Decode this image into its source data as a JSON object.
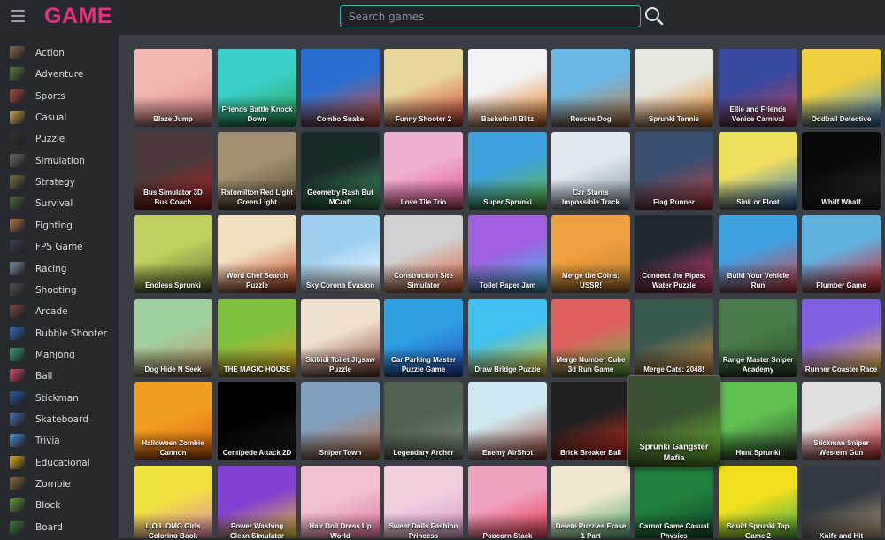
{
  "brand": {
    "logo": "GAME",
    "logo_color": "#e5337b"
  },
  "search": {
    "placeholder": "Search games"
  },
  "sidebar": {
    "items": [
      {
        "label": "Action",
        "icon": "action-icon",
        "color": "#8a6a4a"
      },
      {
        "label": "Adventure",
        "icon": "adventure-icon",
        "color": "#5a7a3a"
      },
      {
        "label": "Sports",
        "icon": "sports-icon",
        "color": "#b04a3a"
      },
      {
        "label": "Casual",
        "icon": "casual-icon",
        "color": "#c9a640"
      },
      {
        "label": "Puzzle",
        "icon": "puzzle-icon",
        "color": "#2c3a2c"
      },
      {
        "label": "Simulation",
        "icon": "simulation-icon",
        "color": "#6a6a6a"
      },
      {
        "label": "Strategy",
        "icon": "strategy-icon",
        "color": "#7a7040"
      },
      {
        "label": "Survival",
        "icon": "survival-icon",
        "color": "#4a6a3a"
      },
      {
        "label": "Fighting",
        "icon": "fighting-icon",
        "color": "#b07a3a"
      },
      {
        "label": "FPS Game",
        "icon": "fps-icon",
        "color": "#3a4050"
      },
      {
        "label": "Racing",
        "icon": "racing-icon",
        "color": "#7a8aa0"
      },
      {
        "label": "Shooting",
        "icon": "shooting-icon",
        "color": "#505050"
      },
      {
        "label": "Arcade",
        "icon": "arcade-icon",
        "color": "#7a4a3a"
      },
      {
        "label": "Bubble Shooter",
        "icon": "bubble-shooter-icon",
        "color": "#3a6ac0"
      },
      {
        "label": "Mahjong",
        "icon": "mahjong-icon",
        "color": "#3aa07a"
      },
      {
        "label": "Ball",
        "icon": "ball-icon",
        "color": "#d04a6a"
      },
      {
        "label": "Stickman",
        "icon": "stickman-icon",
        "color": "#2a5aa0"
      },
      {
        "label": "Skateboard",
        "icon": "skateboard-icon",
        "color": "#4a70b0"
      },
      {
        "label": "Trivia",
        "icon": "trivia-icon",
        "color": "#4a90d0"
      },
      {
        "label": "Educational",
        "icon": "educational-icon",
        "color": "#e0b020"
      },
      {
        "label": "Zombie",
        "icon": "zombie-icon",
        "color": "#8a6a3a"
      },
      {
        "label": "Block",
        "icon": "block-icon",
        "color": "#6a9a3a"
      },
      {
        "label": "Board",
        "icon": "board-icon",
        "color": "#3a7a3a"
      }
    ]
  },
  "games": [
    {
      "title": "Blaze Jump",
      "bg": "#f2b8b0",
      "bg2": "#d98080"
    },
    {
      "title": "Friends Battle Knock Down",
      "bg": "#3ad0c8",
      "bg2": "#2aa050"
    },
    {
      "title": "Combo Snake",
      "bg": "#2a6fd0",
      "bg2": "#e05030"
    },
    {
      "title": "Funny Shooter 2",
      "bg": "#e8d8a0",
      "bg2": "#d04030"
    },
    {
      "title": "Basketball Blitz",
      "bg": "#f2f2f2",
      "bg2": "#e87a20"
    },
    {
      "title": "Rescue Dog",
      "bg": "#6ab8e8",
      "bg2": "#c88040"
    },
    {
      "title": "Sprunki Tennis",
      "bg": "#e8e8e0",
      "bg2": "#e08020"
    },
    {
      "title": "Ellie and Friends Venice Carnival",
      "bg": "#3a4aa0",
      "bg2": "#c04050"
    },
    {
      "title": "Oddball Detective",
      "bg": "#f0d040",
      "bg2": "#3a80d0"
    },
    {
      "title": "Bus Simulator 3D Bus Coach",
      "bg": "#4a3a3a",
      "bg2": "#b02020"
    },
    {
      "title": "Ratomilton Red Light Green Light",
      "bg": "#a09070",
      "bg2": "#504030"
    },
    {
      "title": "Geometry Rash But MCraft",
      "bg": "#1a2a2a",
      "bg2": "#40a060"
    },
    {
      "title": "Love Tile Trio",
      "bg": "#f0b0d0",
      "bg2": "#e05090"
    },
    {
      "title": "Super Sprunki",
      "bg": "#40a0e0",
      "bg2": "#60c040"
    },
    {
      "title": "Car Stunts Impossible Track",
      "bg": "#e0e8f0",
      "bg2": "#8090a0"
    },
    {
      "title": "Flag Runner",
      "bg": "#3a5070",
      "bg2": "#c04040"
    },
    {
      "title": "Sink or Float",
      "bg": "#f0e060",
      "bg2": "#3070c0"
    },
    {
      "title": "Whiff Whaff",
      "bg": "#0a0a0a",
      "bg2": "#303030"
    },
    {
      "title": "Endless Sprunki",
      "bg": "#c0d060",
      "bg2": "#607030"
    },
    {
      "title": "Word Chef Search Puzzle",
      "bg": "#f0e0c0",
      "bg2": "#c04020"
    },
    {
      "title": "Sky Corona Evasion",
      "bg": "#a0d0f0",
      "bg2": "#ffffff"
    },
    {
      "title": "Construction Site Simulator",
      "bg": "#d0d0d0",
      "bg2": "#e06030"
    },
    {
      "title": "Toilet Paper Jam",
      "bg": "#a060e0",
      "bg2": "#40c0e0"
    },
    {
      "title": "Merge the Coins: USSR!",
      "bg": "#f0a040",
      "bg2": "#c08030"
    },
    {
      "title": "Connect the Pipes: Water Puzzle",
      "bg": "#202830",
      "bg2": "#e04080"
    },
    {
      "title": "Build Your Vehicle Run",
      "bg": "#40a0e0",
      "bg2": "#e04040"
    },
    {
      "title": "Plumber Game",
      "bg": "#60b0e0",
      "bg2": "#e02020"
    },
    {
      "title": "Dog Hide N Seek",
      "bg": "#a0d0a0",
      "bg2": "#c09060"
    },
    {
      "title": "THE MAGIC HOUSE",
      "bg": "#80c040",
      "bg2": "#e0a020"
    },
    {
      "title": "Skibidi Toilet Jigsaw Puzzle",
      "bg": "#f0e0d0",
      "bg2": "#804030"
    },
    {
      "title": "Car Parking Master Puzzle Game",
      "bg": "#30a0e0",
      "bg2": "#2050c0"
    },
    {
      "title": "Draw Bridge Puzzle",
      "bg": "#40c0f0",
      "bg2": "#f0d020"
    },
    {
      "title": "Merge Number Cube 3d Run Game",
      "bg": "#e06060",
      "bg2": "#60c040"
    },
    {
      "title": "Merge Cats: 2048!",
      "bg": "#3a5a50",
      "bg2": "#e09040"
    },
    {
      "title": "Range Master Sniper Academy",
      "bg": "#4a7a4a",
      "bg2": "#2a4a2a"
    },
    {
      "title": "Runner Coaster Race",
      "bg": "#8060e0",
      "bg2": "#f0c030"
    },
    {
      "title": "Halloween Zombie Cannon",
      "bg": "#f0a020",
      "bg2": "#e06010"
    },
    {
      "title": "Centipede Attack 2D",
      "bg": "#000000",
      "bg2": "#202020"
    },
    {
      "title": "Sniper Town",
      "bg": "#80a0c0",
      "bg2": "#c07040"
    },
    {
      "title": "Legendary Archer",
      "bg": "#506050",
      "bg2": "#809080"
    },
    {
      "title": "Enemy AirShot",
      "bg": "#d0e8f0",
      "bg2": "#a04030"
    },
    {
      "title": "Brick Breaker Ball",
      "bg": "#202020",
      "bg2": "#e03020"
    },
    {
      "title": "Sprunki Gangster Mafia",
      "bg": "#3a5030",
      "bg2": "#70c030"
    },
    {
      "title": "Hunt Sprunki",
      "bg": "#60c050",
      "bg2": "#304030"
    },
    {
      "title": "Stickman Sniper Western Gun",
      "bg": "#e0e0e0",
      "bg2": "#d03030"
    },
    {
      "title": "L.O.L OMG Girls Coloring Book",
      "bg": "#f0e040",
      "bg2": "#e080c0"
    },
    {
      "title": "Power Washing Clean Simulator",
      "bg": "#8040d0",
      "bg2": "#f0d020"
    },
    {
      "title": "Hair Doll Dress Up World",
      "bg": "#f0c0d0",
      "bg2": "#e070a0"
    },
    {
      "title": "Sweet Dolls Fashion Princess",
      "bg": "#f0d0e0",
      "bg2": "#d090c0"
    },
    {
      "title": "Popcorn Stack",
      "bg": "#f0a0c0",
      "bg2": "#e03040"
    },
    {
      "title": "Delete Puzzles Erase 1 Part",
      "bg": "#f0e8d0",
      "bg2": "#40a060"
    },
    {
      "title": "Carnot Game Casual Physics",
      "bg": "#208040",
      "bg2": "#104020"
    },
    {
      "title": "Squid Sprunki Tap Game 2",
      "bg": "#f0e020",
      "bg2": "#30a040"
    },
    {
      "title": "Knife and Hit",
      "bg": "#303840",
      "bg2": "#c0a080"
    }
  ]
}
